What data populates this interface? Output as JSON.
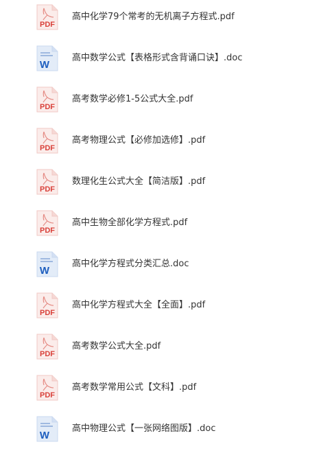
{
  "files": [
    {
      "name": "高中化学79个常考的无机离子方程式.pdf",
      "type": "pdf",
      "icon": "pdf-file-icon",
      "badge": "PDF"
    },
    {
      "name": "高中数学公式【表格形式含背诵口诀】.doc",
      "type": "doc",
      "icon": "word-file-icon",
      "badge": "W"
    },
    {
      "name": "高考数学必修1-5公式大全.pdf",
      "type": "pdf",
      "icon": "pdf-file-icon",
      "badge": "PDF"
    },
    {
      "name": "高考物理公式【必修加选修】.pdf",
      "type": "pdf",
      "icon": "pdf-file-icon",
      "badge": "PDF"
    },
    {
      "name": "数理化生公式大全【简洁版】.pdf",
      "type": "pdf",
      "icon": "pdf-file-icon",
      "badge": "PDF"
    },
    {
      "name": "高中生物全部化学方程式.pdf",
      "type": "pdf",
      "icon": "pdf-file-icon",
      "badge": "PDF"
    },
    {
      "name": "高中化学方程式分类汇总.doc",
      "type": "doc",
      "icon": "word-file-icon",
      "badge": "W"
    },
    {
      "name": "高中化学方程式大全【全面】.pdf",
      "type": "pdf",
      "icon": "pdf-file-icon",
      "badge": "PDF"
    },
    {
      "name": "高考数学公式大全.pdf",
      "type": "pdf",
      "icon": "pdf-file-icon",
      "badge": "PDF"
    },
    {
      "name": "高考数学常用公式【文科】.pdf",
      "type": "pdf",
      "icon": "pdf-file-icon",
      "badge": "PDF"
    },
    {
      "name": "高中物理公式【一张网络图版】.doc",
      "type": "doc",
      "icon": "word-file-icon",
      "badge": "W"
    }
  ],
  "colors": {
    "pdf_accent": "#d9413a",
    "pdf_page": "#fbecea",
    "word_accent": "#1f5fbf",
    "word_page": "#e3ecf8",
    "text": "#333333"
  }
}
